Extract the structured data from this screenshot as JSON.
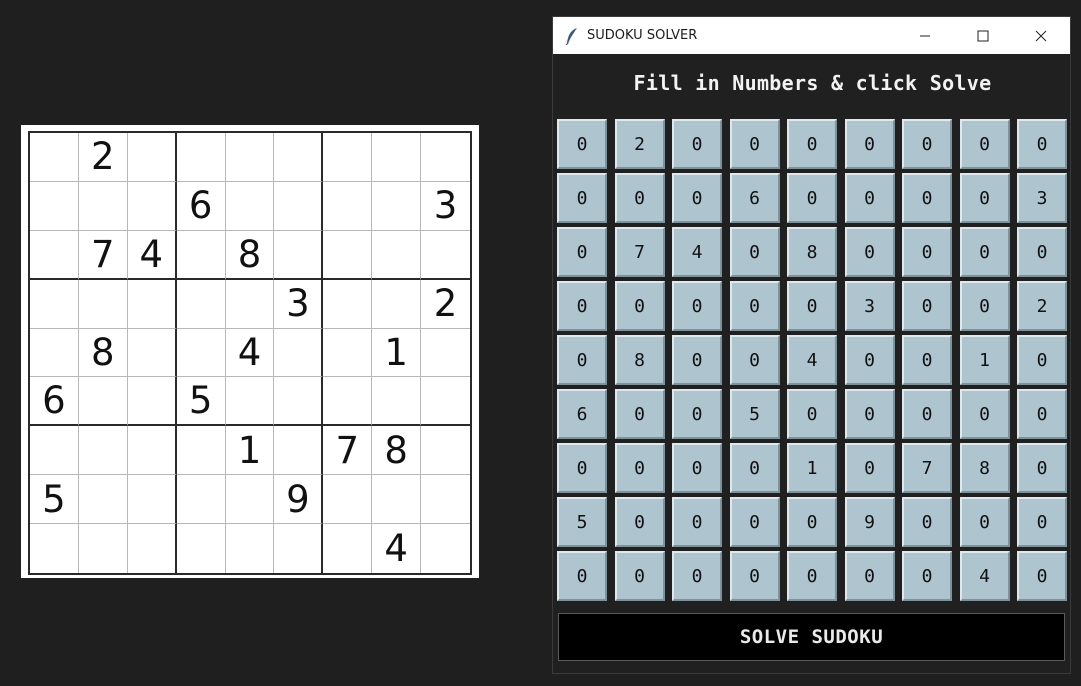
{
  "window": {
    "title": "SUDOKU SOLVER",
    "heading": "Fill in Numbers & click Solve",
    "solve_button": "SOLVE SUDOKU",
    "icons": {
      "app": "feather-icon",
      "minimize": "minimize-icon",
      "maximize": "maximize-icon",
      "close": "close-icon"
    }
  },
  "reference_puzzle": {
    "rows": [
      [
        "",
        "2",
        "",
        "",
        "",
        "",
        "",
        "",
        ""
      ],
      [
        "",
        "",
        "",
        "6",
        "",
        "",
        "",
        "",
        "3"
      ],
      [
        "",
        "7",
        "4",
        "",
        "8",
        "",
        "",
        "",
        ""
      ],
      [
        "",
        "",
        "",
        "",
        "",
        "3",
        "",
        "",
        "2"
      ],
      [
        "",
        "8",
        "",
        "",
        "4",
        "",
        "",
        "1",
        ""
      ],
      [
        "6",
        "",
        "",
        "5",
        "",
        "",
        "",
        "",
        ""
      ],
      [
        "",
        "",
        "",
        "",
        "1",
        "",
        "7",
        "8",
        ""
      ],
      [
        "5",
        "",
        "",
        "",
        "",
        "9",
        "",
        "",
        ""
      ],
      [
        "",
        "",
        "",
        "",
        "",
        "",
        "",
        "4",
        ""
      ]
    ]
  },
  "board": {
    "rows": [
      [
        "0",
        "2",
        "0",
        "0",
        "0",
        "0",
        "0",
        "0",
        "0"
      ],
      [
        "0",
        "0",
        "0",
        "6",
        "0",
        "0",
        "0",
        "0",
        "3"
      ],
      [
        "0",
        "7",
        "4",
        "0",
        "8",
        "0",
        "0",
        "0",
        "0"
      ],
      [
        "0",
        "0",
        "0",
        "0",
        "0",
        "3",
        "0",
        "0",
        "2"
      ],
      [
        "0",
        "8",
        "0",
        "0",
        "4",
        "0",
        "0",
        "1",
        "0"
      ],
      [
        "6",
        "0",
        "0",
        "5",
        "0",
        "0",
        "0",
        "0",
        "0"
      ],
      [
        "0",
        "0",
        "0",
        "0",
        "1",
        "0",
        "7",
        "8",
        "0"
      ],
      [
        "5",
        "0",
        "0",
        "0",
        "0",
        "9",
        "0",
        "0",
        "0"
      ],
      [
        "0",
        "0",
        "0",
        "0",
        "0",
        "0",
        "0",
        "4",
        "0"
      ]
    ]
  },
  "colors": {
    "cell_bg": "#aec4ce",
    "window_bg": "#202020",
    "desktop_bg": "#1f1f1f",
    "button_bg": "#000000"
  }
}
